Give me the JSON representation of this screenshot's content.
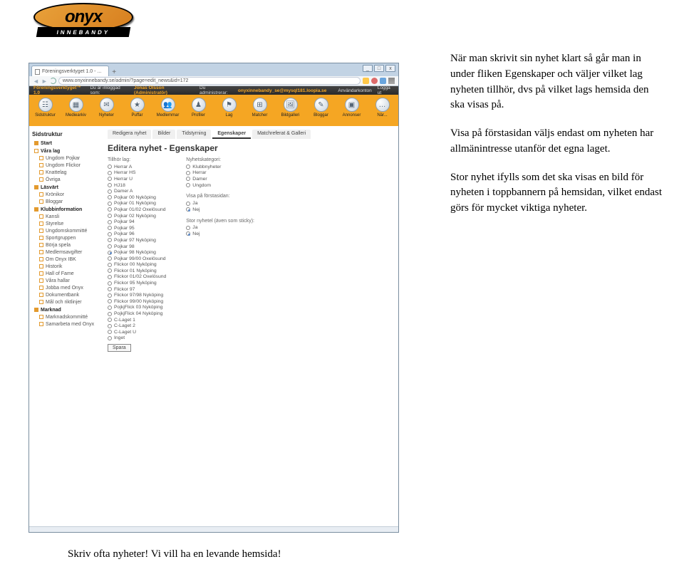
{
  "logo": {
    "name": "onyx",
    "subtitle": "INNEBANDY"
  },
  "right_text": {
    "p1": "När man skrivit sin nyhet klart så går man in under fliken Egenskaper och väljer vilket lag nyheten tillhör, dvs på vilket lags hemsida den ska visas på.",
    "p2": "Visa på förstasidan väljs endast om nyheten har allmänintresse utanför det egna laget.",
    "p3": "Stor nyhet ifylls som det ska visas en bild för nyheten i toppbannern på hemsidan, vilket endast görs för mycket viktiga nyheter."
  },
  "bottom_text": "Skriv ofta nyheter! Vi vill ha en levande hemsida!",
  "browser": {
    "tab_title": "Föreningsverktyget 1.0 - ...",
    "url": "www.onyxinnebandy.se/admin/?page=edit_news&id=172",
    "login_version": "Föreningsverktyget™ 1.0",
    "login_as_label": "Du är inloggad som:",
    "login_user": "Jonas Olsson (Administratör)",
    "login_admin_label": "Du administrerar:",
    "login_domain": "onyxinnebandy_se@mysql181.loopia.se",
    "login_right1": "Användarkonton",
    "login_right2": "Logga ut",
    "nav": [
      "Sidstruktur",
      "Mediearkiv",
      "Nyheter",
      "Puffar",
      "Medlemmar",
      "Profiler",
      "Lag",
      "Matcher",
      "Bildgalleri",
      "Bloggar",
      "Annonser",
      "När..."
    ],
    "sidebar": {
      "title": "Sidstruktur",
      "groups": [
        {
          "label": "Start",
          "filled": true,
          "items": []
        },
        {
          "label": "Våra lag",
          "filled": false,
          "items": [
            "Ungdom Pojkar",
            "Ungdom Flickor",
            "Knattelag",
            "Övriga"
          ]
        },
        {
          "label": "Läsvärt",
          "filled": true,
          "items": [
            "Krönikor",
            "Bloggar"
          ]
        },
        {
          "label": "Klubbinformation",
          "filled": true,
          "items": [
            "Kansli",
            "Styrelse",
            "Ungdomskommitté",
            "Sportgruppen",
            "Börja spela",
            "Medlemsavgifter",
            "Om Onyx IBK",
            "Historik",
            "Hall of Fame",
            "Våra hallar",
            "Jobba med Onyx",
            "Dokumentbank",
            "Mål och riktlinjer"
          ]
        },
        {
          "label": "Marknad",
          "filled": true,
          "items": [
            "Marknadskommitté",
            "Samarbeta med Onyx"
          ]
        }
      ]
    },
    "main": {
      "param_tabs": [
        "Redigera nyhet",
        "Bilder",
        "Tidstyrning",
        "Egenskaper",
        "Matchreferat & Galleri"
      ],
      "active_tab": "Egenskaper",
      "heading": "Editera nyhet - Egenskaper",
      "col1_head": "Tillhör lag:",
      "col1": [
        "Herrar A",
        "Herrar HS",
        "Herrar U",
        "HJ18",
        "Damer A",
        "Pojkar 00 Nyköping",
        "Pojkar 01 Nyköping",
        "Pojkar 01/02 Oxelösund",
        "Pojkar 02 Nyköping",
        "Pojkar 94",
        "Pojkar 95",
        "Pojkar 96",
        "Pojkar 97 Nyköping",
        "Pojkar 98",
        "Pojkar 98 Nyköping",
        "Pojkar 99/00 Oxelösund",
        "Flickor 00 Nyköping",
        "Flickor 01 Nyköping",
        "Flickor 01/02 Oxelösund",
        "Flickor 95 Nyköping",
        "Flickor 97",
        "Flickor 97/98 Nyköping",
        "Flickor 99/00 Nyköping",
        "PojkjFlick 03 Nyköping",
        "PojkjFlick 04 Nyköping",
        "C-Laget 1",
        "C-Laget 2",
        "C-Laget U",
        "Inget"
      ],
      "col1_selected": "Pojkar 98 Nyköping",
      "col2_head": "Nyhetskategori:",
      "col2": [
        "Klubbnyheter",
        "Herrar",
        "Damer",
        "Ungdom"
      ],
      "q1_head": "Visa på förstasidan:",
      "q1": [
        "Ja",
        "Nej"
      ],
      "q1_sel": "Nej",
      "q2_head": "Stor nyhetel (även som sticky):",
      "q2": [
        "Ja",
        "Nej"
      ],
      "q2_sel": "Nej",
      "save": "Spara"
    }
  }
}
